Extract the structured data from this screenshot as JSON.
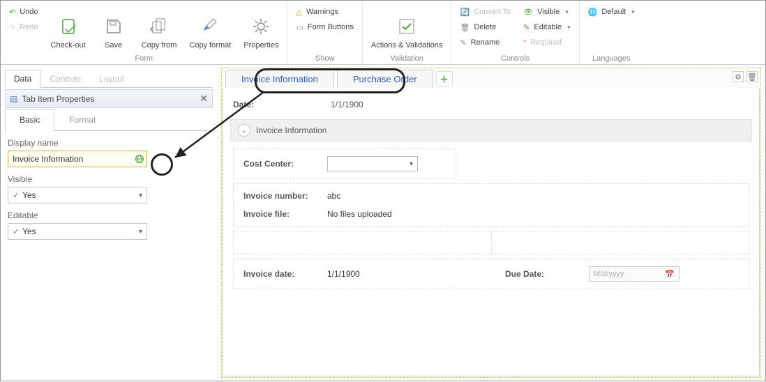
{
  "ribbon": {
    "undo": "Undo",
    "redo": "Redo",
    "checkout": "Check-out",
    "save": "Save",
    "copyfrom": "Copy from",
    "copyformat": "Copy format",
    "properties": "Properties",
    "group_form": "Form",
    "warnings": "Warnings",
    "formbuttons": "Form Buttons",
    "group_show": "Show",
    "actionsvalidations": "Actions & Validations",
    "group_validation": "Validation",
    "convertto": "Convert To",
    "delete": "Delete",
    "rename": "Rename",
    "visible": "Visible",
    "editable": "Editable",
    "required": "Required",
    "group_controls": "Controls",
    "default": "Default",
    "group_languages": "Languages"
  },
  "left": {
    "tab_data": "Data",
    "tab_controls": "Controls",
    "tab_layout": "Layout",
    "header_title": "Tab Item Properties",
    "sub_basic": "Basic",
    "sub_format": "Format",
    "displayname_label": "Display name",
    "displayname_value": "Invoice Information",
    "visible_label": "Visible",
    "visible_value": "Yes",
    "editable_label": "Editable",
    "editable_value": "Yes"
  },
  "canvas": {
    "tab1": "Invoice Information",
    "tab2": "Purchase Order",
    "date_label": "Date:",
    "date_value": "1/1/1900",
    "section_title": "Invoice Information",
    "costcenter_label": "Cost Center:",
    "invoicenumber_label": "Invoice number:",
    "invoicenumber_value": "abc",
    "invoicefile_label": "Invoice file:",
    "invoicefile_value": "No files uploaded",
    "invoicedate_label": "Invoice date:",
    "invoicedate_value": "1/1/1900",
    "duedate_label": "Due Date:",
    "duedate_placeholder": "M/d/yyyy"
  }
}
